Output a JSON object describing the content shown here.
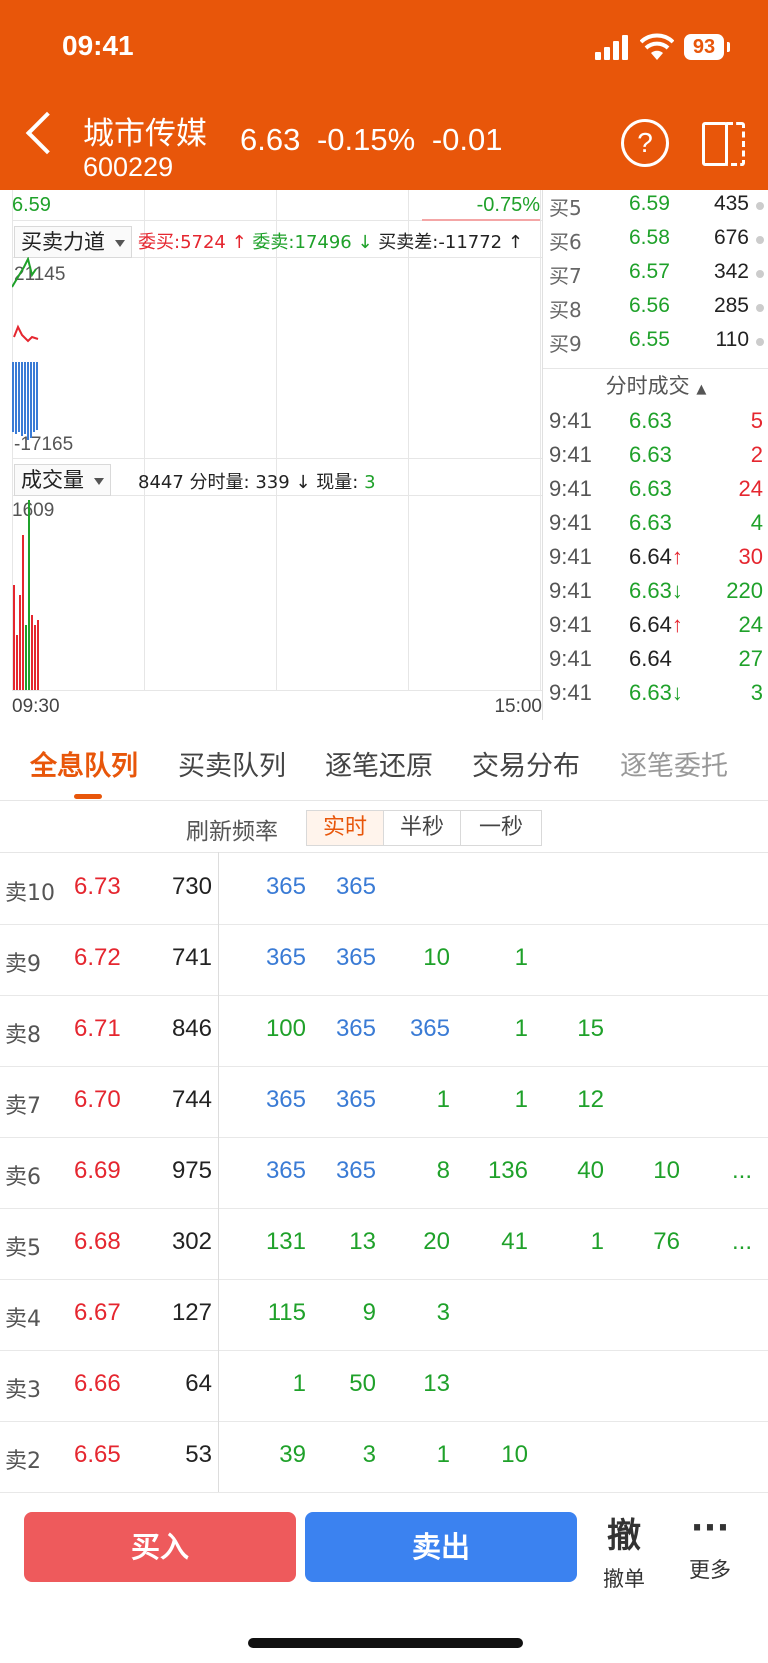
{
  "status": {
    "time": "09:41",
    "battery": "93"
  },
  "header": {
    "name": "城市传媒",
    "code": "600229",
    "price": "6.63",
    "pct": "-0.15%",
    "chg": "-0.01",
    "help": "?"
  },
  "chart": {
    "top_left_price": "6.59",
    "top_right_pct": "-0.75%",
    "power": {
      "dropdown": "买卖力道",
      "buy_label": "委买:",
      "buy_val": "5724",
      "sell_label": "委卖:",
      "sell_val": "17496",
      "diff_label": "买卖差:",
      "diff_val": "-11772",
      "ymax": "21145",
      "ymin": "-17165"
    },
    "volume": {
      "dropdown": "成交量",
      "total": "8447",
      "fs_label": "分时量:",
      "fs_val": "339",
      "now_label": "现量:",
      "now_val": "3",
      "ymax": "1609"
    },
    "time_start": "09:30",
    "time_end": "15:00"
  },
  "order_book": [
    {
      "label": "买5",
      "price": "6.59",
      "vol": "435"
    },
    {
      "label": "买6",
      "price": "6.58",
      "vol": "676"
    },
    {
      "label": "买7",
      "price": "6.57",
      "vol": "342"
    },
    {
      "label": "买8",
      "price": "6.56",
      "vol": "285"
    },
    {
      "label": "买9",
      "price": "6.55",
      "vol": "110"
    }
  ],
  "trades_title": "分时成交",
  "trades": [
    {
      "time": "9:41",
      "price": "6.63",
      "arrow": "",
      "vol": "5",
      "pc": "green",
      "vc": "red"
    },
    {
      "time": "9:41",
      "price": "6.63",
      "arrow": "",
      "vol": "2",
      "pc": "green",
      "vc": "red"
    },
    {
      "time": "9:41",
      "price": "6.63",
      "arrow": "",
      "vol": "24",
      "pc": "green",
      "vc": "red"
    },
    {
      "time": "9:41",
      "price": "6.63",
      "arrow": "",
      "vol": "4",
      "pc": "green",
      "vc": "green"
    },
    {
      "time": "9:41",
      "price": "6.64",
      "arrow": "↑",
      "vol": "30",
      "pc": "black",
      "vc": "red"
    },
    {
      "time": "9:41",
      "price": "6.63",
      "arrow": "↓",
      "vol": "220",
      "pc": "green",
      "vc": "green"
    },
    {
      "time": "9:41",
      "price": "6.64",
      "arrow": "↑",
      "vol": "24",
      "pc": "black",
      "vc": "green"
    },
    {
      "time": "9:41",
      "price": "6.64",
      "arrow": "",
      "vol": "27",
      "pc": "black",
      "vc": "green"
    },
    {
      "time": "9:41",
      "price": "6.63",
      "arrow": "↓",
      "vol": "3",
      "pc": "green",
      "vc": "green"
    }
  ],
  "tabs": [
    "全息队列",
    "买卖队列",
    "逐笔还原",
    "交易分布",
    "逐笔委托"
  ],
  "refresh": {
    "label": "刷新频率",
    "options": [
      "实时",
      "半秒",
      "一秒"
    ]
  },
  "queue": [
    {
      "lvl": "卖10",
      "price": "6.73",
      "total": "730",
      "cells": [
        [
          "365",
          "blue"
        ],
        [
          "365",
          "blue"
        ]
      ]
    },
    {
      "lvl": "卖9",
      "price": "6.72",
      "total": "741",
      "cells": [
        [
          "365",
          "blue"
        ],
        [
          "365",
          "blue"
        ],
        [
          "10",
          "green"
        ],
        [
          "1",
          "green"
        ]
      ]
    },
    {
      "lvl": "卖8",
      "price": "6.71",
      "total": "846",
      "cells": [
        [
          "100",
          "green"
        ],
        [
          "365",
          "blue"
        ],
        [
          "365",
          "blue"
        ],
        [
          "1",
          "green"
        ],
        [
          "15",
          "green"
        ]
      ]
    },
    {
      "lvl": "卖7",
      "price": "6.70",
      "total": "744",
      "cells": [
        [
          "365",
          "blue"
        ],
        [
          "365",
          "blue"
        ],
        [
          "1",
          "green"
        ],
        [
          "1",
          "green"
        ],
        [
          "12",
          "green"
        ]
      ]
    },
    {
      "lvl": "卖6",
      "price": "6.69",
      "total": "975",
      "cells": [
        [
          "365",
          "blue"
        ],
        [
          "365",
          "blue"
        ],
        [
          "8",
          "green"
        ],
        [
          "136",
          "green"
        ],
        [
          "40",
          "green"
        ],
        [
          "10",
          "green"
        ],
        [
          "...",
          "green"
        ]
      ]
    },
    {
      "lvl": "卖5",
      "price": "6.68",
      "total": "302",
      "cells": [
        [
          "131",
          "green"
        ],
        [
          "13",
          "green"
        ],
        [
          "20",
          "green"
        ],
        [
          "41",
          "green"
        ],
        [
          "1",
          "green"
        ],
        [
          "76",
          "green"
        ],
        [
          "...",
          "green"
        ]
      ]
    },
    {
      "lvl": "卖4",
      "price": "6.67",
      "total": "127",
      "cells": [
        [
          "115",
          "green"
        ],
        [
          "9",
          "green"
        ],
        [
          "3",
          "green"
        ]
      ]
    },
    {
      "lvl": "卖3",
      "price": "6.66",
      "total": "64",
      "cells": [
        [
          "1",
          "green"
        ],
        [
          "50",
          "green"
        ],
        [
          "13",
          "green"
        ]
      ]
    },
    {
      "lvl": "卖2",
      "price": "6.65",
      "total": "53",
      "cells": [
        [
          "39",
          "green"
        ],
        [
          "3",
          "green"
        ],
        [
          "1",
          "green"
        ],
        [
          "10",
          "green"
        ]
      ]
    }
  ],
  "bottom": {
    "buy": "买入",
    "sell": "卖出",
    "cancel_icon": "撤",
    "cancel": "撤单",
    "more_icon": "···",
    "more": "更多"
  }
}
